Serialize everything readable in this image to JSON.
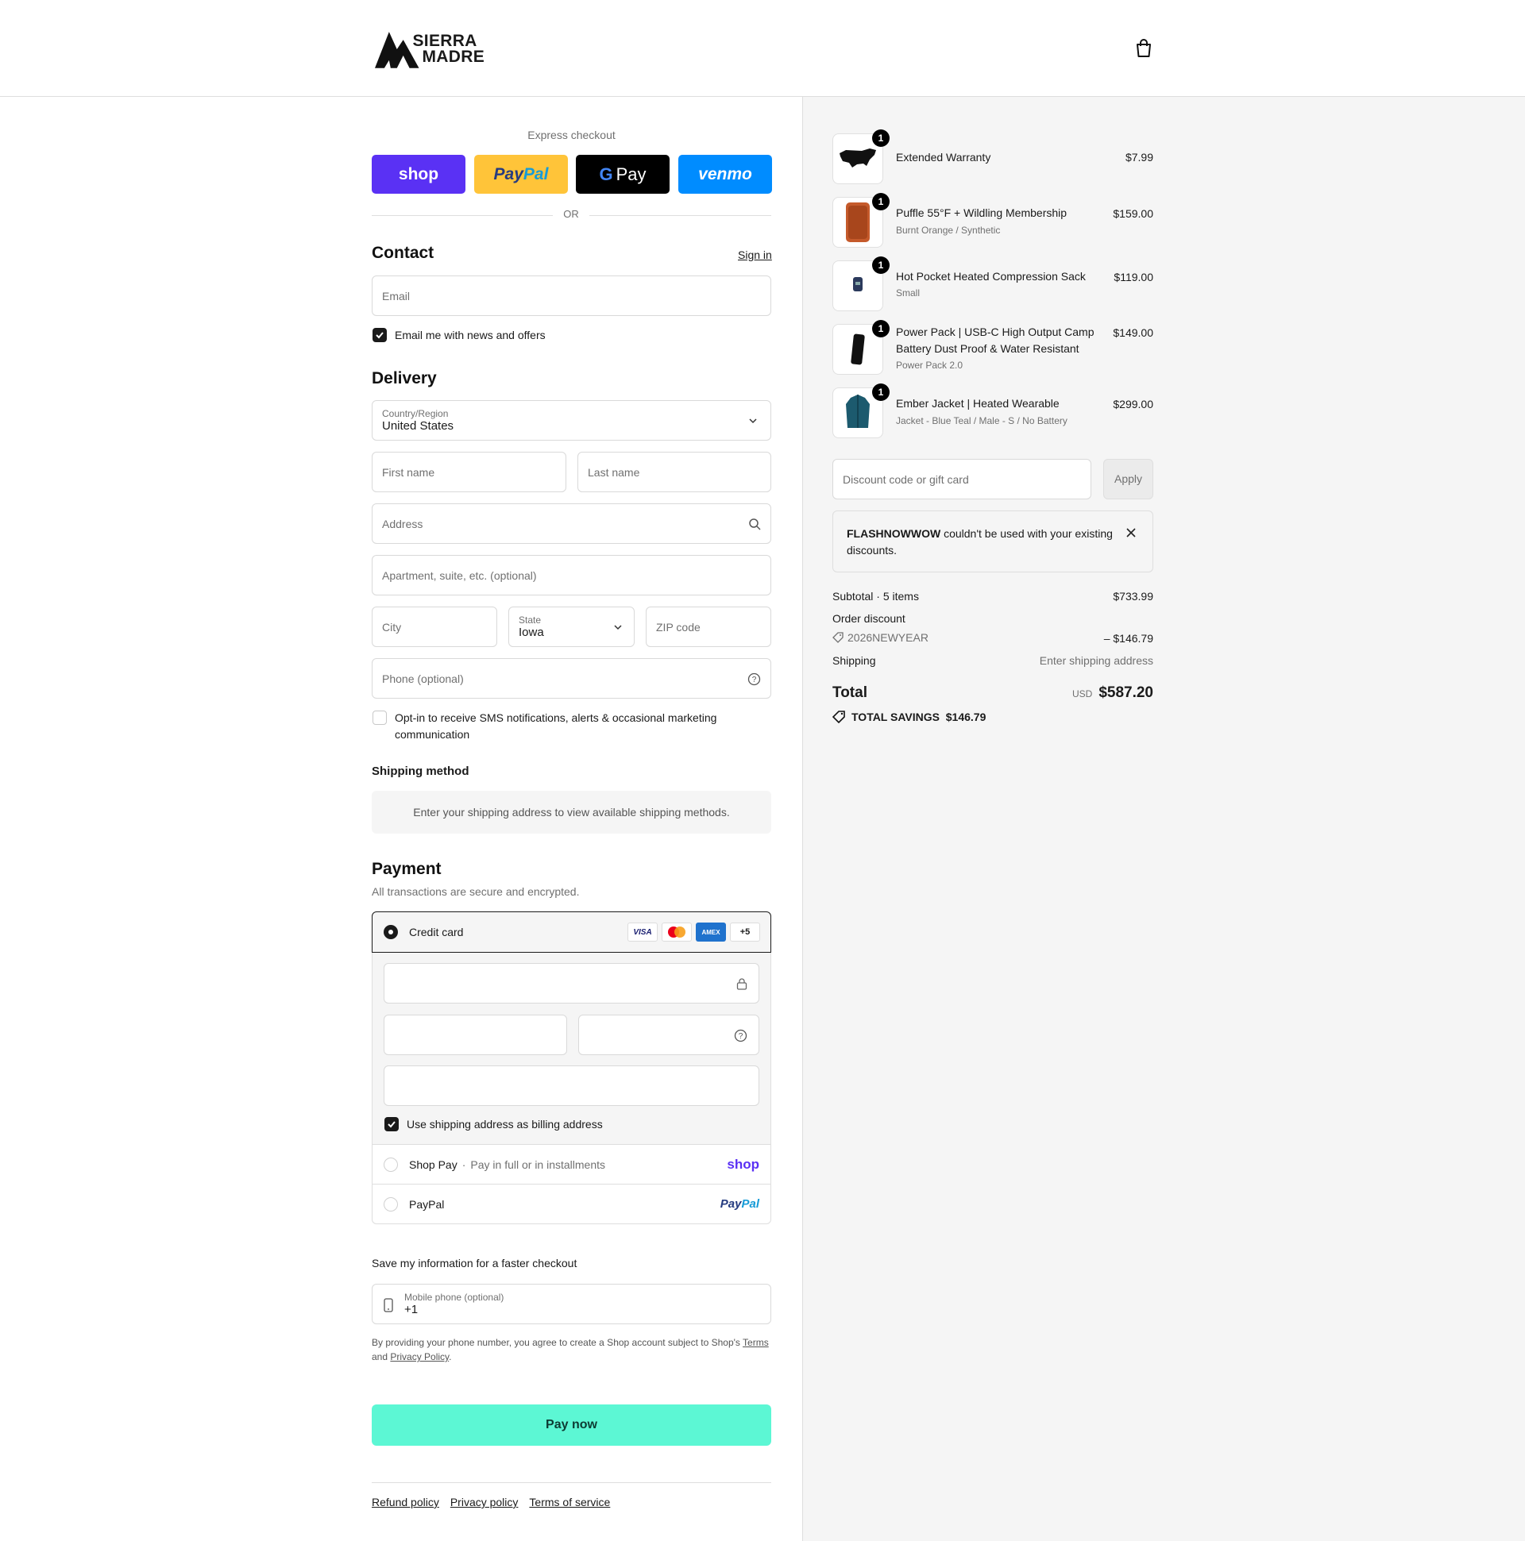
{
  "brand": {
    "name_line1": "SIERRA",
    "name_line2": "MADRE"
  },
  "express": {
    "title": "Express checkout",
    "buttons": [
      {
        "label": "shop",
        "color": "#5a31f4"
      },
      {
        "label": "PayPal",
        "color": "#ffc439"
      },
      {
        "label": "Pay",
        "color": "#000000"
      },
      {
        "label": "venmo",
        "color": "#008cff"
      }
    ],
    "or": "OR"
  },
  "contact": {
    "heading": "Contact",
    "sign_in": "Sign in",
    "email_placeholder": "Email",
    "news_label": "Email me with news and offers",
    "news_checked": true
  },
  "delivery": {
    "heading": "Delivery",
    "country_label": "Country/Region",
    "country_value": "United States",
    "first_name": "First name",
    "last_name": "Last name",
    "address": "Address",
    "apartment": "Apartment, suite, etc. (optional)",
    "city": "City",
    "state_label": "State",
    "state_value": "Iowa",
    "zip": "ZIP code",
    "phone": "Phone (optional)",
    "sms_label_1": "Opt-in to receive SMS notifications, alerts & occasional marketing",
    "sms_label_2": "communication",
    "sms_checked": false
  },
  "shipping": {
    "heading": "Shipping method",
    "message": "Enter your shipping address to view available shipping methods."
  },
  "payment": {
    "heading": "Payment",
    "subtitle": "All transactions are secure and encrypted.",
    "credit_card": "Credit card",
    "cards": [
      "VISA",
      "AMEX",
      "+5"
    ],
    "billing_label": "Use shipping address as billing address",
    "billing_checked": true,
    "shoppay_label": "Shop Pay",
    "shoppay_sub": "Pay in full or in installments",
    "shoppay_logo": "shop",
    "paypal_label": "PayPal",
    "paypal_logo": "PayPal"
  },
  "save": {
    "heading": "Save my information for a faster checkout",
    "mobile_label": "Mobile phone (optional)",
    "mobile_value": "+1",
    "legal_1": "By providing your phone number, you agree to create a Shop account subject to Shop's",
    "terms": "Terms",
    "and": "and",
    "privacy": "Privacy Policy",
    "period": "."
  },
  "pay_now": {
    "label": "Pay now",
    "color": "#5cf7d4"
  },
  "footer": {
    "links": [
      "Refund policy",
      "Privacy policy",
      "Terms of service"
    ]
  },
  "summary": {
    "items": [
      {
        "name": "Extended Warranty",
        "variant": "",
        "price": "$7.99",
        "qty": "1"
      },
      {
        "name": "Puffle 55°F + Wildling Membership",
        "variant": "Burnt Orange / Synthetic",
        "price": "$159.00",
        "qty": "1"
      },
      {
        "name": "Hot Pocket Heated Compression Sack",
        "variant": "Small",
        "price": "$119.00",
        "qty": "1"
      },
      {
        "name_1": "Power Pack | USB-C High Output Camp",
        "name_2": "Battery Dust Proof & Water Resistant",
        "variant": "Power Pack 2.0",
        "price": "$149.00",
        "qty": "1"
      },
      {
        "name": "Ember Jacket | Heated Wearable",
        "variant": "Jacket - Blue Teal / Male - S / No Battery",
        "price": "$299.00",
        "qty": "1"
      }
    ],
    "discount_placeholder": "Discount code or gift card",
    "apply": "Apply",
    "error_code": "FLASHNOWWOW",
    "error_rest_1": " couldn't be used with your existing",
    "error_rest_2": "discounts.",
    "subtotal_label": "Subtotal · 5 items",
    "subtotal_value": "$733.99",
    "order_discount": "Order discount",
    "discount_code": "2026NEWYEAR",
    "discount_value": "– $146.79",
    "shipping_label": "Shipping",
    "shipping_value": "Enter shipping address",
    "total_label": "Total",
    "currency": "USD",
    "total_value": "$587.20",
    "savings_label": "TOTAL SAVINGS",
    "savings_value": "$146.79"
  }
}
